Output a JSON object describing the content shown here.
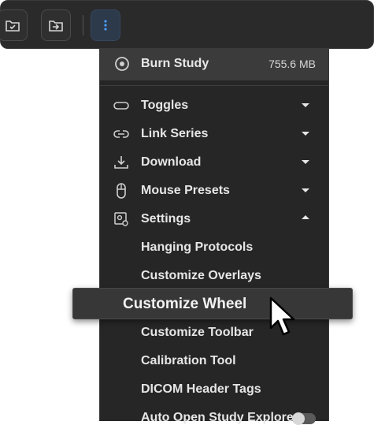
{
  "toolbar": {
    "buttons": [
      {
        "icon": "folder-check-icon"
      },
      {
        "icon": "folder-import-icon"
      },
      {
        "icon": "more-vertical-icon"
      }
    ]
  },
  "menu": {
    "burn": {
      "label": "Burn Study",
      "size": "755.6 MB",
      "icon": "disc-icon"
    },
    "items": [
      {
        "label": "Toggles",
        "icon": "toggle-icon",
        "state": "collapsed"
      },
      {
        "label": "Link Series",
        "icon": "link-icon",
        "state": "collapsed"
      },
      {
        "label": "Download",
        "icon": "download-icon",
        "state": "collapsed"
      },
      {
        "label": "Mouse Presets",
        "icon": "mouse-icon",
        "state": "collapsed"
      },
      {
        "label": "Settings",
        "icon": "settings-icon",
        "state": "expanded"
      }
    ],
    "settings_sub": [
      {
        "label": "Hanging Protocols"
      },
      {
        "label": "Customize Overlays"
      },
      {
        "label": "Customize Wheel",
        "highlighted": true
      },
      {
        "label": "Customize Toolbar"
      },
      {
        "label": "Calibration Tool"
      },
      {
        "label": "DICOM Header Tags"
      },
      {
        "label": "Auto Open Study Explorer",
        "toggle": false
      }
    ]
  },
  "colors": {
    "toolbar_bg": "#2a2a2b",
    "menu_bg": "#262627",
    "active_button": "#2c3a4c",
    "accent_icon": "#4a9eff"
  }
}
